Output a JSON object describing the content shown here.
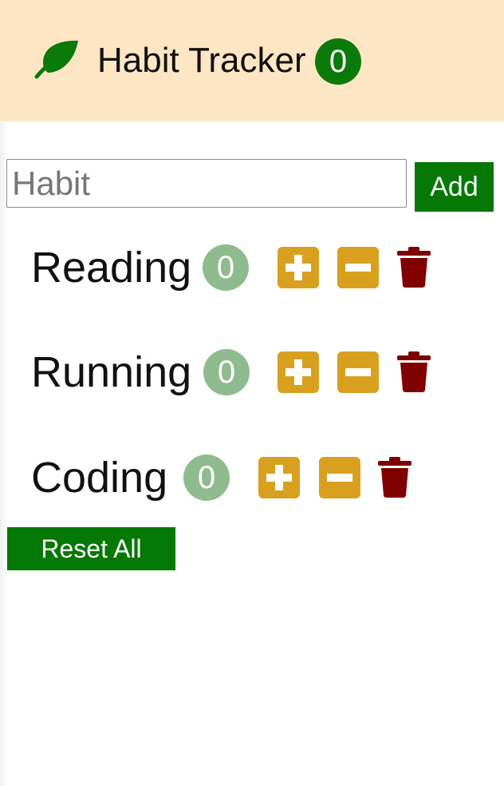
{
  "header": {
    "title": "Habit Tracker",
    "total_count": "0",
    "icon": "leaf-icon"
  },
  "form": {
    "placeholder": "Habit",
    "value": "",
    "add_label": "Add"
  },
  "habits": [
    {
      "name": "Reading",
      "count": "0"
    },
    {
      "name": "Running",
      "count": "0"
    },
    {
      "name": "Coding",
      "count": "0"
    }
  ],
  "actions": {
    "increment_icon": "plus-icon",
    "decrement_icon": "minus-icon",
    "delete_icon": "trash-icon"
  },
  "reset_label": "Reset All",
  "colors": {
    "header_bg": "#fde6c4",
    "primary_green": "#067806",
    "count_badge_green": "#0a7a0a",
    "habit_count_bg": "#8fbc8f",
    "button_gold": "#d9a020",
    "trash_red": "#800000"
  }
}
